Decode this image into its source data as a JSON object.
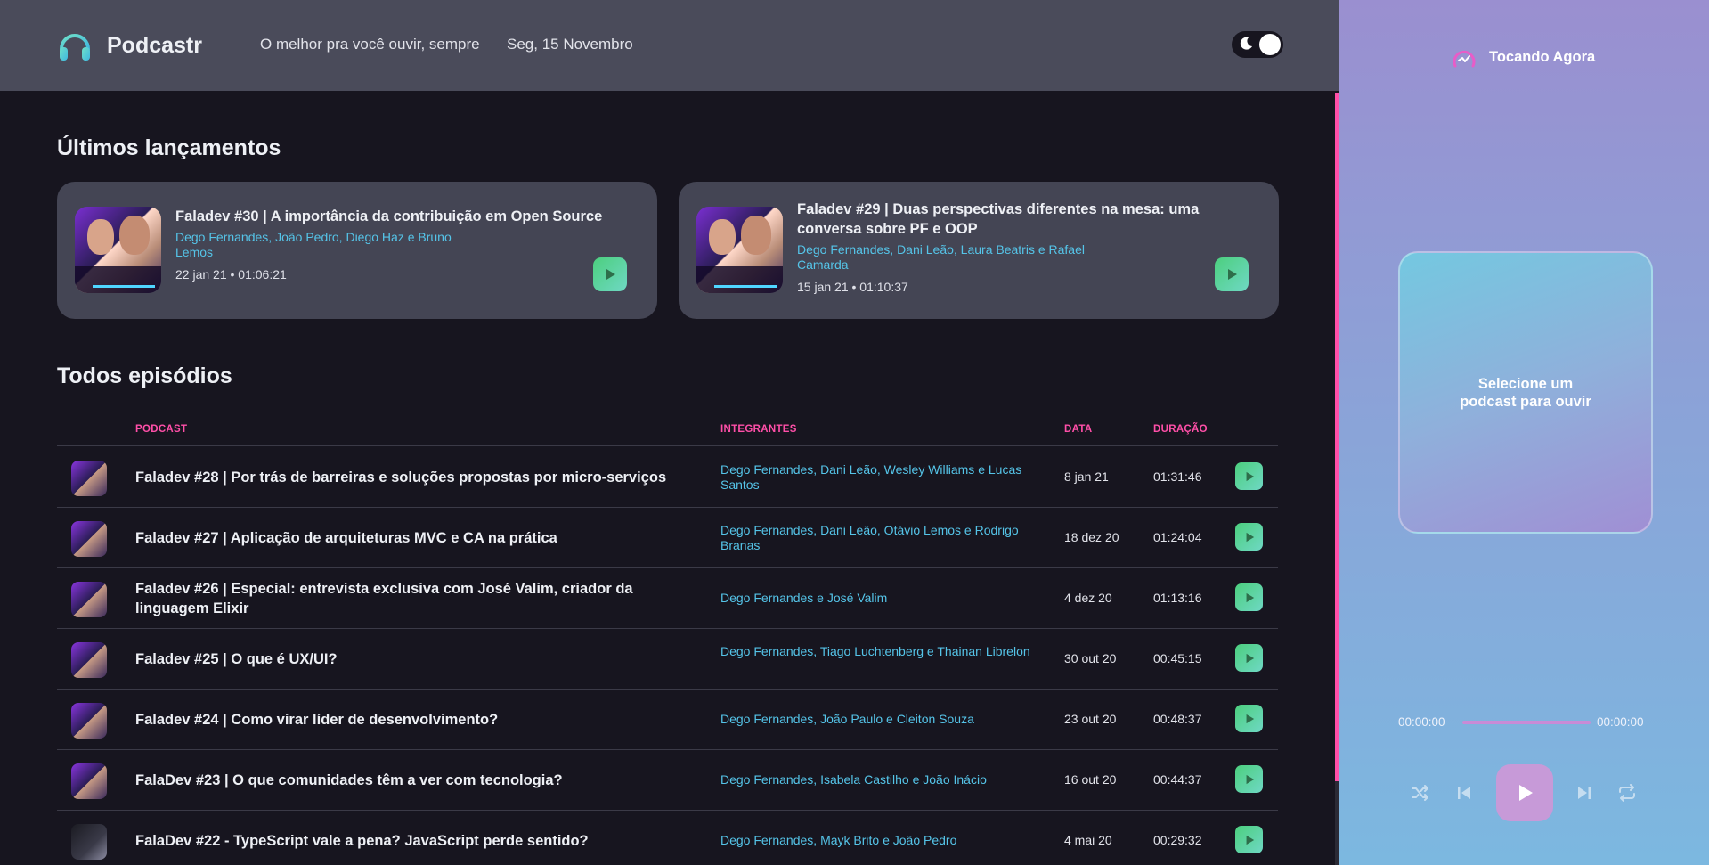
{
  "header": {
    "app_name": "Podcastr",
    "tagline": "O melhor pra você ouvir, sempre",
    "date": "Seg, 15 Novembro"
  },
  "latest": {
    "title": "Últimos lançamentos",
    "episodes": [
      {
        "title": "Faladev #30 | A importância da contribuição em Open Source",
        "members": "Dego Fernandes, João Pedro, Diego Haz e Bruno Lemos",
        "meta": "22 jan 21 • 01:06:21"
      },
      {
        "title": "Faladev #29 | Duas perspectivas diferentes na mesa: uma conversa sobre PF e OOP",
        "members": "Dego Fernandes, Dani Leão, Laura Beatris e Rafael Camarda",
        "meta": "15 jan 21 • 01:10:37"
      }
    ]
  },
  "all": {
    "title": "Todos episódios",
    "columns": {
      "podcast": "PODCAST",
      "members": "INTEGRANTES",
      "date": "DATA",
      "duration": "DURAÇÃO"
    },
    "rows": [
      {
        "title": "Faladev #28 | Por trás de barreiras e soluções propostas por micro-serviços",
        "members": "Dego Fernandes, Dani Leão, Wesley Williams e Lucas Santos",
        "date": "8 jan 21",
        "duration": "01:31:46"
      },
      {
        "title": "Faladev #27 | Aplicação de arquiteturas MVC e CA na prática",
        "members": "Dego Fernandes, Dani Leão, Otávio Lemos e Rodrigo Branas",
        "date": "18 dez 20",
        "duration": "01:24:04"
      },
      {
        "title": "Faladev #26 | Especial: entrevista exclusiva com José Valim, criador da linguagem Elixir",
        "members": "Dego Fernandes e José Valim",
        "date": "4 dez 20",
        "duration": "01:13:16"
      },
      {
        "title": "Faladev #25 | O que é UX/UI?",
        "members": "Dego Fernandes, Tiago Luchtenberg e Thainan Librelon",
        "date": "30 out 20",
        "duration": "00:45:15"
      },
      {
        "title": "Faladev #24 | Como virar líder de desenvolvimento?",
        "members": "Dego Fernandes, João Paulo e Cleiton Souza",
        "date": "23 out 20",
        "duration": "00:48:37"
      },
      {
        "title": "FalaDev #23 | O que comunidades têm a ver com tecnologia?",
        "members": "Dego Fernandes, Isabela Castilho e João Inácio",
        "date": "16 out 20",
        "duration": "00:44:37"
      },
      {
        "title": "FalaDev #22 - TypeScript vale a pena? JavaScript perde sentido?",
        "members": "Dego Fernandes, Mayk Brito e João Pedro",
        "date": "4 mai 20",
        "duration": "00:29:32"
      }
    ]
  },
  "player": {
    "title": "Tocando Agora",
    "empty_message": "Selecione um podcast para ouvir",
    "time_current": "00:00:00",
    "time_total": "00:00:00"
  },
  "colors": {
    "accent_pink": "#ff4fa8",
    "member_blue": "#55c4e8",
    "play_green": "#4ccf7e",
    "header_bg": "#4a4b5a",
    "page_bg": "#17151f"
  },
  "icons": {
    "logo": "headphones-icon",
    "theme": "moon-icon",
    "play": "play-icon",
    "shuffle": "shuffle-icon",
    "previous": "skip-previous-icon",
    "next": "skip-next-icon",
    "repeat": "repeat-icon",
    "now_playing": "playing-icon"
  }
}
